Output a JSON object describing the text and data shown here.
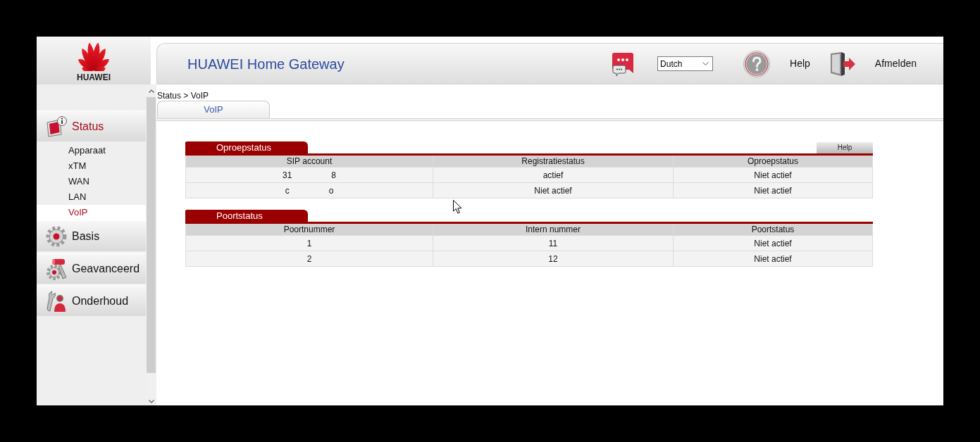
{
  "header": {
    "logo_text": "HUAWEI",
    "title": "HUAWEI Home Gateway",
    "language": "Dutch",
    "help": "Help",
    "logout": "Afmelden"
  },
  "sidebar": {
    "groups": [
      {
        "label": "Status",
        "selected": true,
        "items": [
          {
            "label": "Apparaat",
            "selected": false
          },
          {
            "label": "xTM",
            "selected": false
          },
          {
            "label": "WAN",
            "selected": false
          },
          {
            "label": "LAN",
            "selected": false
          },
          {
            "label": "VoIP",
            "selected": true
          }
        ]
      },
      {
        "label": "Basis",
        "selected": false
      },
      {
        "label": "Geavanceerd",
        "selected": false
      },
      {
        "label": "Onderhoud",
        "selected": false
      }
    ]
  },
  "breadcrumb": "Status > VoIP",
  "tabs": [
    {
      "label": "VoIP",
      "selected": true
    }
  ],
  "sections": [
    {
      "title": "Oproepstatus",
      "help_button": "Help",
      "columns": [
        "SIP account",
        "Registratiestatus",
        "Oproepstatus"
      ],
      "rows": [
        [
          {
            "visible_parts": [
              "31",
              "8"
            ]
          },
          "actief",
          "Niet actief"
        ],
        [
          {
            "visible_parts": [
              "c",
              "o"
            ]
          },
          "Niet actief",
          "Niet actief"
        ]
      ]
    },
    {
      "title": "Poortstatus",
      "columns": [
        "Poortnummer",
        "Intern nummer",
        "Poortstatus"
      ],
      "rows": [
        [
          "1",
          "11",
          "Niet actief"
        ],
        [
          "2",
          "12",
          "Niet actief"
        ]
      ]
    }
  ]
}
